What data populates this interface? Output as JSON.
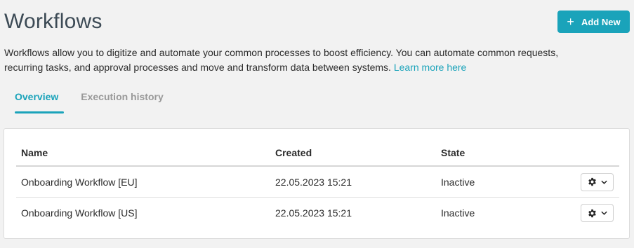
{
  "header": {
    "title": "Workflows",
    "add_button_label": "Add New"
  },
  "description": {
    "text": "Workflows allow you to digitize and automate your common processes to boost efficiency. You can automate common requests, recurring tasks, and approval processes and move and transform data between systems.",
    "link_label": "Learn more here"
  },
  "tabs": [
    {
      "label": "Overview",
      "active": true
    },
    {
      "label": "Execution history",
      "active": false
    }
  ],
  "table": {
    "columns": [
      "Name",
      "Created",
      "State"
    ],
    "rows": [
      {
        "name": "Onboarding Workflow [EU]",
        "created": "22.05.2023 15:21",
        "state": "Inactive"
      },
      {
        "name": "Onboarding Workflow [US]",
        "created": "22.05.2023 15:21",
        "state": "Inactive"
      }
    ]
  },
  "icons": {
    "add": "plus-icon",
    "row_actions": "gear-icon",
    "dropdown": "chevron-down-icon"
  },
  "colors": {
    "accent": "#1aa3ba",
    "title": "#3c4a55",
    "background": "#f2f2f2"
  }
}
